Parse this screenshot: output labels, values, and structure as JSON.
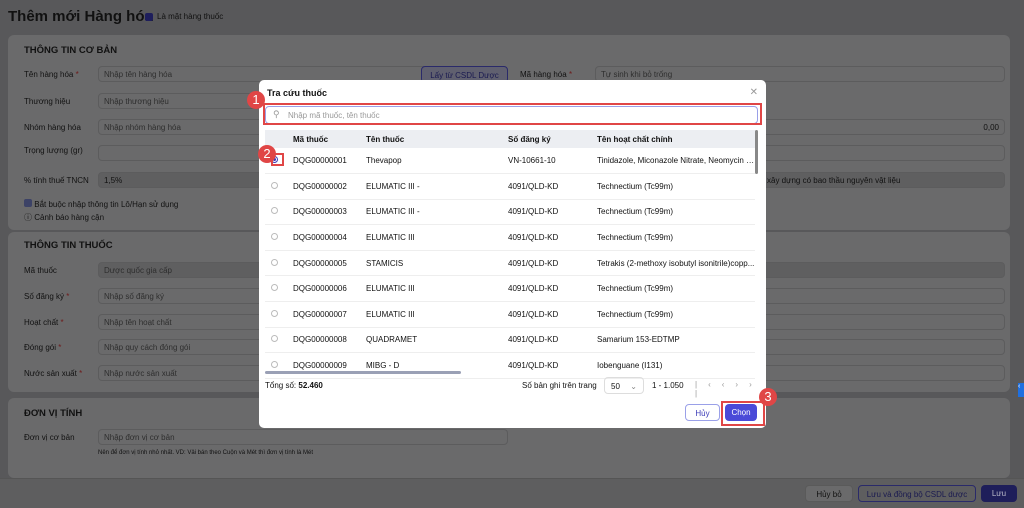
{
  "page": {
    "title": "Thêm mới Hàng hóa",
    "is_drug_label": "Là mặt hàng thuốc",
    "basic": {
      "heading": "THÔNG TIN CƠ BẢN",
      "name_label": "Tên hàng hóa",
      "name_ph": "Nhập tên hàng hóa",
      "fetch_btn": "Lấy từ CSDL Dược",
      "code_label": "Mã hàng hóa",
      "code_ph": "Tự sinh khi bỏ trống",
      "brand_label": "Thương hiệu",
      "brand_ph": "Nhập thương hiệu",
      "group_label": "Nhóm hàng hóa",
      "group_ph": "Nhập nhóm hàng hóa",
      "weight_label": "Trọng lượng (gr)",
      "price_value": "0,00",
      "tax_label": "% tính thuế TNCN",
      "tax_value": "1,5%",
      "tax_type": "xây dựng có bao thầu nguyên vật liệu",
      "lot_label": "Bắt buộc nhập thông tin Lô/Hạn sử dụng",
      "warn_label": "Cảnh báo hàng cận"
    },
    "drug": {
      "heading": "THÔNG TIN THUỐC",
      "code_label": "Mã thuốc",
      "code_ph": "Dược quốc gia cấp",
      "reg_label": "Số đăng ký",
      "reg_ph": "Nhập số đăng ký",
      "active_label": "Hoạt chất",
      "active_ph": "Nhập tên hoạt chất",
      "pack_label": "Đóng gói",
      "pack_ph": "Nhập quy cách đóng gói",
      "country_label": "Nước sản xuất",
      "country_ph": "Nhập nước sản xuất"
    },
    "unit": {
      "heading": "ĐƠN VỊ TÍNH",
      "base_label": "Đơn vị cơ bản",
      "base_ph": "Nhập đơn vị cơ bản",
      "hint": "Nên để đơn vị tính nhỏ nhất. VD: Vải bán theo Cuộn và Mét thì đơn vị tính là Mét"
    },
    "footer": {
      "cancel": "Hủy bỏ",
      "save_sync": "Lưu và đồng bộ CSDL dược",
      "save": "Lưu"
    }
  },
  "modal": {
    "title": "Tra cứu thuốc",
    "search_ph": "Nhập mã thuốc, tên thuốc",
    "columns": [
      "Mã thuốc",
      "Tên thuốc",
      "Số đăng ký",
      "Tên hoạt chất chính"
    ],
    "rows": [
      {
        "code": "DQG00000001",
        "name": "Thevapop",
        "reg": "VN-10661-10",
        "active": "Tinidazole, Miconazole Nitrate, Neomycin S...",
        "selected": true
      },
      {
        "code": "DQG00000002",
        "name": "ELUMATIC III -",
        "reg": "4091/QLD-KD",
        "active": "Technectium (Tc99m)"
      },
      {
        "code": "DQG00000003",
        "name": "ELUMATIC III -",
        "reg": "4091/QLD-KD",
        "active": "Technectium (Tc99m)"
      },
      {
        "code": "DQG00000004",
        "name": "ELUMATIC III",
        "reg": "4091/QLD-KD",
        "active": "Technectium (Tc99m)"
      },
      {
        "code": "DQG00000005",
        "name": "STAMICIS",
        "reg": "4091/QLD-KD",
        "active": "Tetrakis (2-methoxy isobutyl isonitrile)copp..."
      },
      {
        "code": "DQG00000006",
        "name": "ELUMATIC III",
        "reg": "4091/QLD-KD",
        "active": "Technectium (Tc99m)"
      },
      {
        "code": "DQG00000007",
        "name": "ELUMATIC III",
        "reg": "4091/QLD-KD",
        "active": "Technectium (Tc99m)"
      },
      {
        "code": "DQG00000008",
        "name": "QUADRAMET",
        "reg": "4091/QLD-KD",
        "active": "Samarium 153-EDTMP"
      },
      {
        "code": "DQG00000009",
        "name": "MIBG - D",
        "reg": "4091/QLD-KD",
        "active": "Iobenguane (I131)"
      }
    ],
    "total_label": "Tổng số:",
    "total": "52.460",
    "per_page_label": "Số bản ghi trên trang",
    "per_page": "50",
    "range": "1 - 1.050",
    "cancel": "Hủy",
    "choose": "Chọn"
  },
  "annotations": [
    "1",
    "2",
    "3"
  ]
}
